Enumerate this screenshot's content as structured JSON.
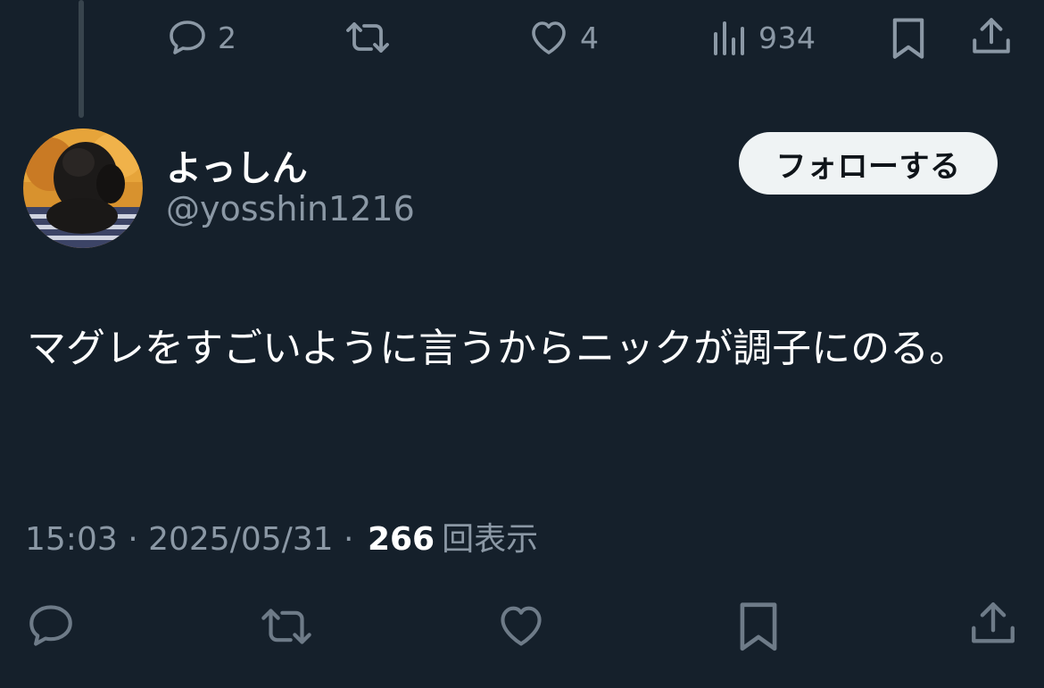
{
  "prev_tweet_actions": {
    "reply_count": "2",
    "like_count": "4",
    "views_count": "934"
  },
  "author": {
    "display_name": "よっしん",
    "handle": "@yosshin1216"
  },
  "follow_button": {
    "label": "フォローする"
  },
  "tweet": {
    "text": "マグレをすごいように言うからニックが調子にのる。"
  },
  "meta": {
    "time": "15:03",
    "separator1": " · ",
    "date": "2025/05/31",
    "separator2": " · ",
    "views_count": "266",
    "views_label": "回表示"
  },
  "colors": {
    "background": "#15202b",
    "muted": "#8b98a5",
    "icon": "#6e7b88",
    "button_bg": "#eff3f4"
  },
  "icons": {
    "top_row": [
      "reply-icon",
      "retweet-icon",
      "like-icon",
      "views-icon",
      "bookmark-icon",
      "share-icon"
    ],
    "bottom_row": [
      "reply-icon",
      "retweet-icon",
      "like-icon",
      "bookmark-icon",
      "share-icon"
    ]
  }
}
